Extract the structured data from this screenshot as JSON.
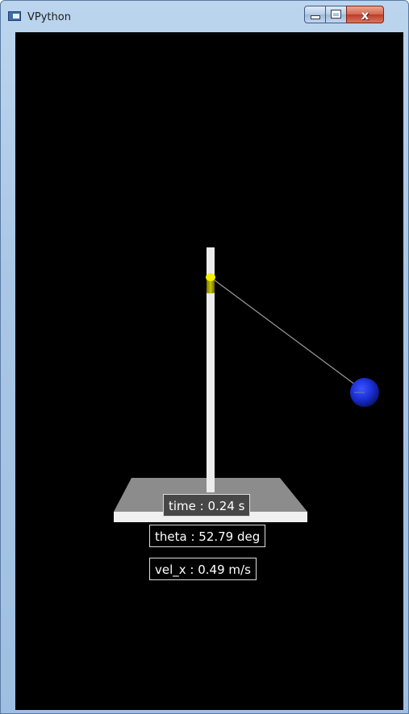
{
  "window": {
    "title": "VPython",
    "app_icon": "vpython-window-icon",
    "controls": {
      "minimize_icon": "minimize-icon",
      "maximize_icon": "maximize-icon",
      "close_glyph": "x"
    }
  },
  "scene": {
    "background": "#000000",
    "pole_color": "#ececec",
    "base_top_color": "#8c8c8c",
    "base_front_color": "#f0f0f0",
    "pivot_color": "#e5e000",
    "string_color": "#9a9a9a",
    "bob_color": "#1b2fd6"
  },
  "labels": {
    "time": "time : 0.24 s",
    "theta": "theta : 52.79 deg",
    "vel_x": "vel_x : 0.49 m/s"
  }
}
